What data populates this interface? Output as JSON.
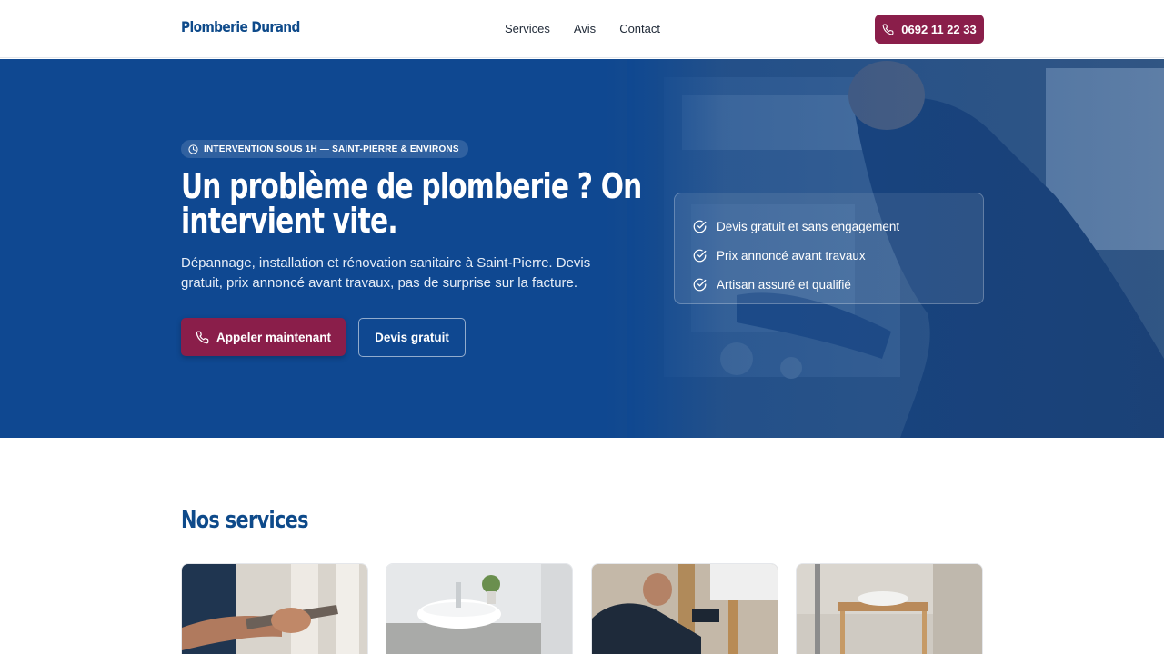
{
  "header": {
    "brand": "Plomberie Durand",
    "nav": [
      "Services",
      "Avis",
      "Contact"
    ],
    "phone": "0692 11 22 33"
  },
  "hero": {
    "badge": "INTERVENTION SOUS 1H — SAINT-PIERRE & ENVIRONS",
    "title": "Un problème de plomberie ? On intervient vite.",
    "subtitle": "Dépannage, installation et rénovation sanitaire à Saint-Pierre. Devis gratuit, prix annoncé avant travaux, pas de surprise sur la facture.",
    "cta_primary": "Appeler maintenant",
    "cta_secondary": "Devis gratuit",
    "checks": [
      "Devis gratuit et sans engagement",
      "Prix annoncé avant travaux",
      "Artisan assuré et qualifié"
    ]
  },
  "services": {
    "title": "Nos services",
    "cards": [
      "plumber-wrench-photo",
      "bathroom-sink-photo",
      "boiler-repair-photo",
      "renovation-photo"
    ]
  },
  "colors": {
    "primary_blue": "#0e4a8a",
    "hero_blue": "#0f4891",
    "accent": "#8a1e4a"
  }
}
